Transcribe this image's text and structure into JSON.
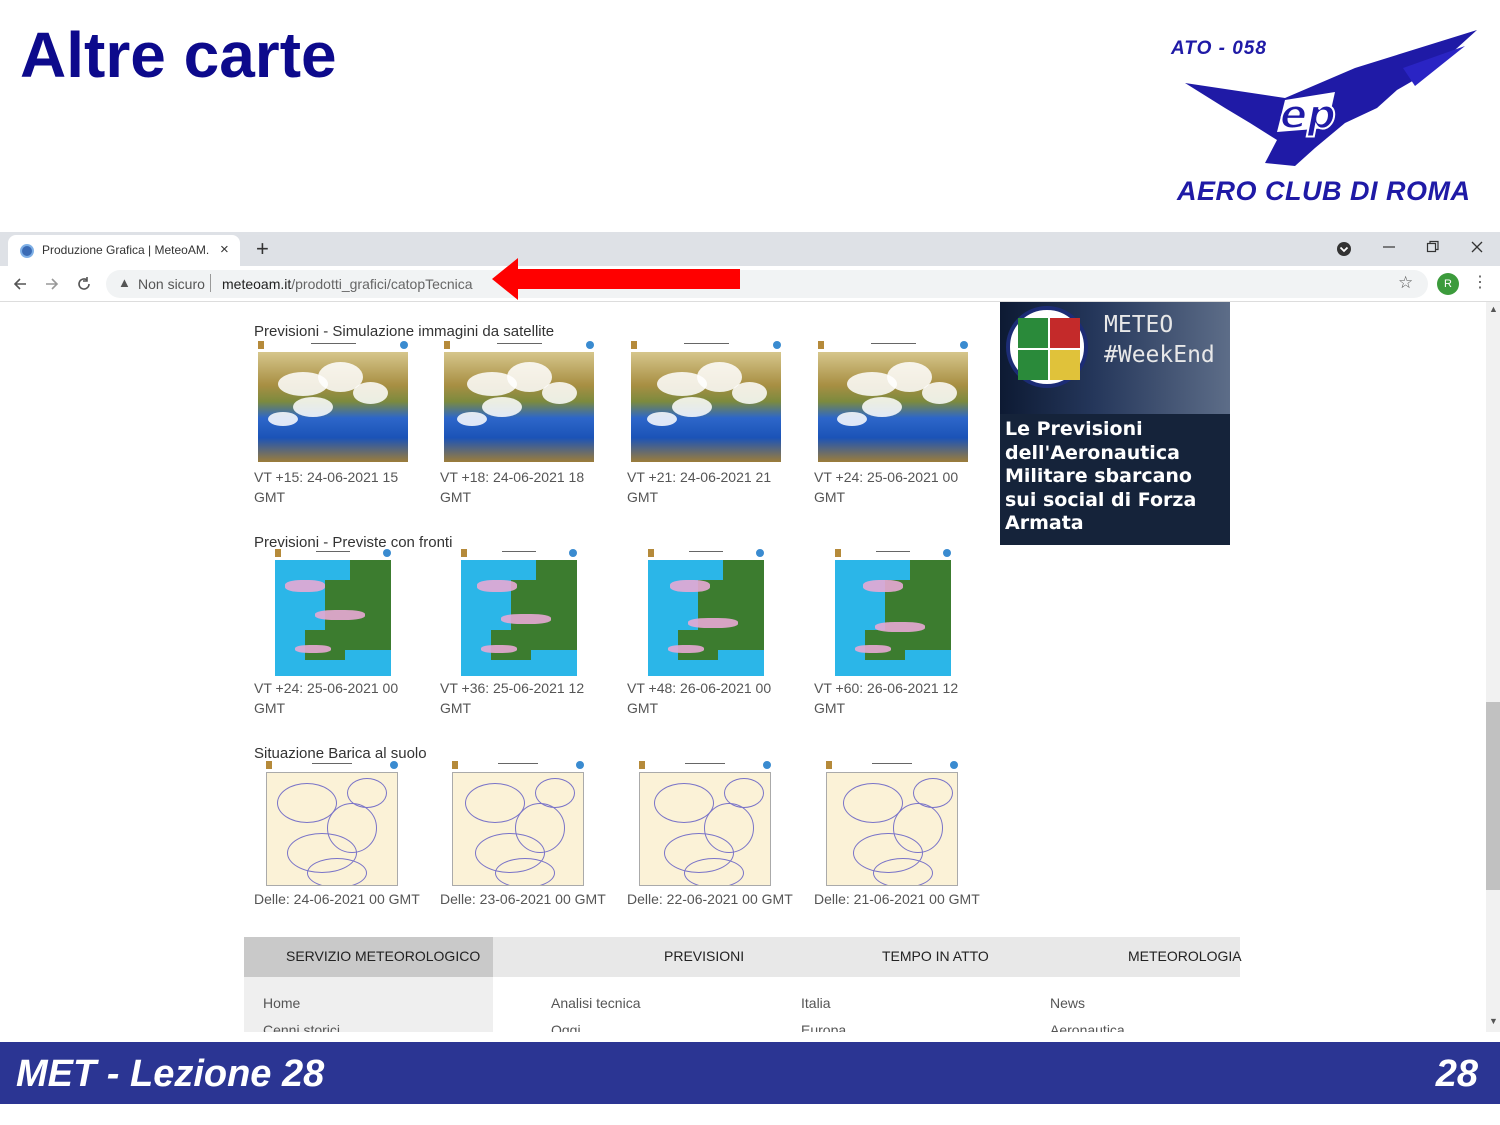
{
  "slide": {
    "title": "Altre carte",
    "logo_code": "ATO - 058",
    "logo_club": "AERO CLUB DI ROMA",
    "footer_lesson": "MET - Lezione 28",
    "page_number": "28"
  },
  "browser": {
    "tab_title": "Produzione Grafica | MeteoAM.it",
    "tab_close": "×",
    "new_tab": "+",
    "security_label": "Non sicuro",
    "url_domain": "meteoam.it",
    "url_path": "/prodotti_grafici/catopTecnica",
    "avatar_letter": "R"
  },
  "sections": [
    {
      "title": "Previsioni - Simulazione immagini da satellite",
      "items": [
        {
          "line1": "VT +15: 24-06-2021 15",
          "line2": "GMT"
        },
        {
          "line1": "VT +18: 24-06-2021 18",
          "line2": "GMT"
        },
        {
          "line1": "VT +21: 24-06-2021 21",
          "line2": "GMT"
        },
        {
          "line1": "VT +24: 25-06-2021 00",
          "line2": "GMT"
        }
      ]
    },
    {
      "title": "Previsioni - Previste con fronti",
      "items": [
        {
          "line1": "VT +24: 25-06-2021 00",
          "line2": "GMT"
        },
        {
          "line1": "VT +36: 25-06-2021 12",
          "line2": "GMT"
        },
        {
          "line1": "VT +48: 26-06-2021 00",
          "line2": "GMT"
        },
        {
          "line1": "VT +60: 26-06-2021 12",
          "line2": "GMT"
        }
      ]
    },
    {
      "title": "Situazione Barica al suolo",
      "items": [
        {
          "line1": "Delle: 24-06-2021 00 GMT"
        },
        {
          "line1": "Delle: 23-06-2021 00 GMT"
        },
        {
          "line1": "Delle: 22-06-2021 00 GMT"
        },
        {
          "line1": "Delle: 21-06-2021 00 GMT"
        }
      ]
    }
  ],
  "ad": {
    "brand_line1": "METEO",
    "brand_line2": "#WeekEnd",
    "text": "Le Previsioni dell'Aeronautica Militare sbarcano sui social di Forza Armata"
  },
  "footer_nav": {
    "items": [
      "SERVIZIO METEOROLOGICO",
      "PREVISIONI",
      "TEMPO IN ATTO",
      "METEOROLOGIA"
    ],
    "links_col1": [
      "Home",
      "Cenni storici"
    ],
    "links_col2": [
      "Analisi tecnica",
      "Oggi"
    ],
    "links_col3": [
      "Italia",
      "Europa"
    ],
    "links_col4": [
      "News",
      "Aeronautica"
    ]
  },
  "colors": {
    "title_blue": "#0d0a8c",
    "footer_bar": "#2b3593",
    "arrow_red": "#ff0000"
  }
}
